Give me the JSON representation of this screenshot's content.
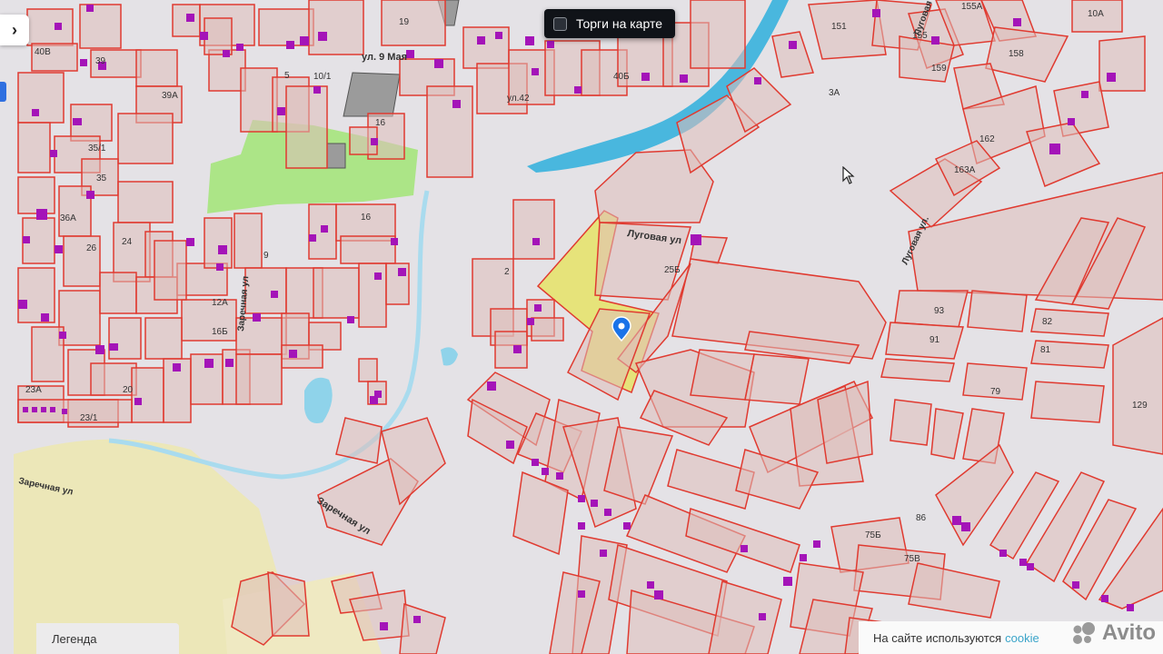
{
  "map": {
    "colors": {
      "background": "#e4e2e6",
      "parcel_fill": "rgba(222,190,185,0.55)",
      "parcel_stroke": "#e03a30",
      "building": "#a414b8",
      "river": "#49b7de",
      "green_zone": "#a5e67c",
      "yellow_zone": "#e6e37a",
      "pale_zone": "#ece7b8",
      "gray_building": "#9b9b9b",
      "marker": "#1a73e8"
    },
    "streets": {
      "ul_9_maya": "ул. 9 Мая",
      "lugovaya_1": "Луговая ул",
      "lugovaya_2": "Луговая ул.",
      "lugovaya_3": "Луговая ул.",
      "zarechnaya_1": "Заречная ул",
      "zarechnaya_2": "Заречная ул",
      "zarechnaya_3": "Заречная ул"
    },
    "numbers": {
      "n40v": "40В",
      "n39": "39",
      "n39a": "39А",
      "n35_1": "35/1",
      "n35": "35",
      "n36a": "36А",
      "n24": "24",
      "n26": "26",
      "n12a": "12А",
      "n16b": "16Б",
      "n23a": "23А",
      "n23_1": "23/1",
      "n20": "20",
      "n10_1": "10/1",
      "n5": "5",
      "n16a": "16",
      "n16b2": "16",
      "n9": "9",
      "n19": "19",
      "n40b": "40Б",
      "n42": "ул.42",
      "n2": "2",
      "n25b": "25Б",
      "n3a": "3А",
      "n151": "151",
      "n155": "155",
      "n155a": "155А",
      "n10a": "10А",
      "n158": "158",
      "n159": "159",
      "n162": "162",
      "n163a": "163А",
      "n93": "93",
      "n91": "91",
      "n82": "82",
      "n81": "81",
      "n79": "79",
      "n129": "129",
      "n86": "86",
      "n75b": "75Б",
      "n75v": "75В"
    },
    "marker": "location-pin"
  },
  "ui": {
    "sidebar_toggle_icon": "chevron-right-icon",
    "auction_label": "Торги на карте",
    "legend_label": "Легенда",
    "cookie_text": "На сайте используются",
    "cookie_link": "cookie",
    "avito_logo": "Avito"
  }
}
